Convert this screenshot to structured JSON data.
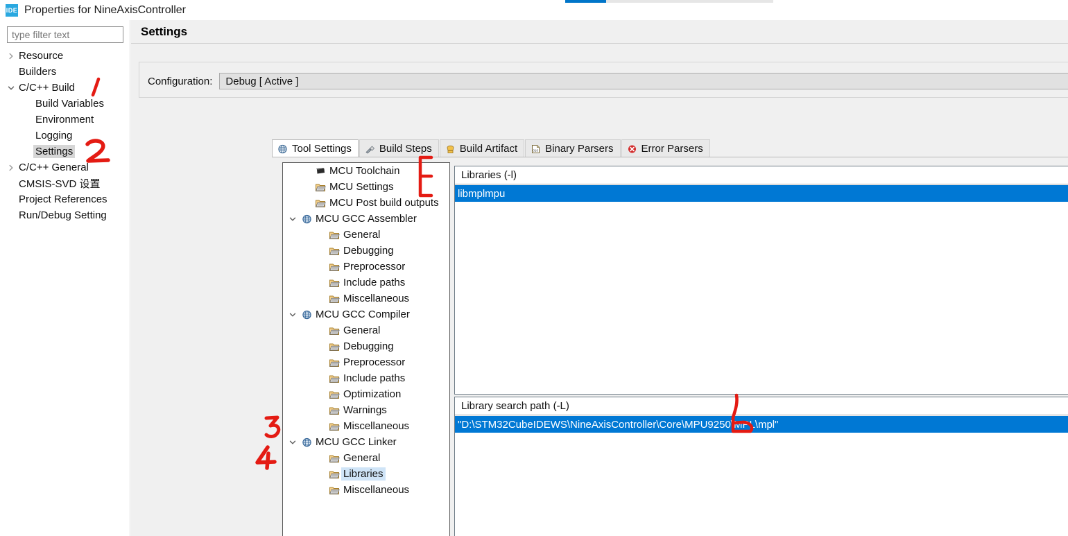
{
  "window": {
    "title": "Properties for NineAxisController",
    "app_icon": "ide-icon",
    "icon_text": "IDE"
  },
  "progress": {
    "percent": 20,
    "color": "#0075c9",
    "track_color": "#e6e6e6"
  },
  "sidebar": {
    "filter": {
      "placeholder": "type filter text",
      "value": ""
    },
    "items": [
      {
        "label": "Resource",
        "indent": 0,
        "twisty": "collapsed",
        "selected": false
      },
      {
        "label": "Builders",
        "indent": 0,
        "twisty": "none",
        "selected": false
      },
      {
        "label": "C/C++ Build",
        "indent": 0,
        "twisty": "expanded",
        "selected": false
      },
      {
        "label": "Build Variables",
        "indent": 1,
        "twisty": "none",
        "selected": false
      },
      {
        "label": "Environment",
        "indent": 1,
        "twisty": "none",
        "selected": false
      },
      {
        "label": "Logging",
        "indent": 1,
        "twisty": "none",
        "selected": false
      },
      {
        "label": "Settings",
        "indent": 1,
        "twisty": "none",
        "selected": true
      },
      {
        "label": "C/C++ General",
        "indent": 0,
        "twisty": "collapsed",
        "selected": false
      },
      {
        "label": "CMSIS-SVD 设置",
        "indent": 0,
        "twisty": "none",
        "selected": false
      },
      {
        "label": "Project References",
        "indent": 0,
        "twisty": "none",
        "selected": false
      },
      {
        "label": "Run/Debug Setting",
        "indent": 0,
        "twisty": "none",
        "selected": false
      }
    ]
  },
  "main": {
    "page_title": "Settings",
    "configuration": {
      "label": "Configuration:",
      "value": "Debug  [ Active ]"
    },
    "tabs": [
      {
        "label": "Tool Settings",
        "icon": "tool-settings-icon",
        "active": true
      },
      {
        "label": "Build Steps",
        "icon": "build-steps-icon",
        "active": false
      },
      {
        "label": "Build Artifact",
        "icon": "build-artifact-icon",
        "active": false
      },
      {
        "label": "Binary Parsers",
        "icon": "binary-parsers-icon",
        "active": false
      },
      {
        "label": "Error Parsers",
        "icon": "error-parsers-icon",
        "active": false
      }
    ],
    "tool_tree": [
      {
        "label": "MCU Toolchain",
        "indent": 1,
        "twisty": "none",
        "icon": "chip-icon",
        "selected": false
      },
      {
        "label": "MCU Settings",
        "indent": 1,
        "twisty": "none",
        "icon": "folder-icon",
        "selected": false
      },
      {
        "label": "MCU Post build outputs",
        "indent": 1,
        "twisty": "none",
        "icon": "folder-icon",
        "selected": false
      },
      {
        "label": "MCU GCC Assembler",
        "indent": 0,
        "twisty": "expanded",
        "icon": "globe-icon",
        "selected": false
      },
      {
        "label": "General",
        "indent": 2,
        "twisty": "none",
        "icon": "folder-icon",
        "selected": false
      },
      {
        "label": "Debugging",
        "indent": 2,
        "twisty": "none",
        "icon": "folder-icon",
        "selected": false
      },
      {
        "label": "Preprocessor",
        "indent": 2,
        "twisty": "none",
        "icon": "folder-icon",
        "selected": false
      },
      {
        "label": "Include paths",
        "indent": 2,
        "twisty": "none",
        "icon": "folder-icon",
        "selected": false
      },
      {
        "label": "Miscellaneous",
        "indent": 2,
        "twisty": "none",
        "icon": "folder-icon",
        "selected": false
      },
      {
        "label": "MCU GCC Compiler",
        "indent": 0,
        "twisty": "expanded",
        "icon": "globe-icon",
        "selected": false
      },
      {
        "label": "General",
        "indent": 2,
        "twisty": "none",
        "icon": "folder-icon",
        "selected": false
      },
      {
        "label": "Debugging",
        "indent": 2,
        "twisty": "none",
        "icon": "folder-icon",
        "selected": false
      },
      {
        "label": "Preprocessor",
        "indent": 2,
        "twisty": "none",
        "icon": "folder-icon",
        "selected": false
      },
      {
        "label": "Include paths",
        "indent": 2,
        "twisty": "none",
        "icon": "folder-icon",
        "selected": false
      },
      {
        "label": "Optimization",
        "indent": 2,
        "twisty": "none",
        "icon": "folder-icon",
        "selected": false
      },
      {
        "label": "Warnings",
        "indent": 2,
        "twisty": "none",
        "icon": "folder-icon",
        "selected": false
      },
      {
        "label": "Miscellaneous",
        "indent": 2,
        "twisty": "none",
        "icon": "folder-icon",
        "selected": false
      },
      {
        "label": "MCU GCC Linker",
        "indent": 0,
        "twisty": "expanded",
        "icon": "globe-icon",
        "selected": false
      },
      {
        "label": "General",
        "indent": 2,
        "twisty": "none",
        "icon": "folder-icon",
        "selected": false
      },
      {
        "label": "Libraries",
        "indent": 2,
        "twisty": "none",
        "icon": "folder-icon",
        "selected": true
      },
      {
        "label": "Miscellaneous",
        "indent": 2,
        "twisty": "none",
        "icon": "folder-icon",
        "selected": false
      }
    ],
    "libraries_panel": {
      "header": "Libraries (-l)",
      "items": [
        {
          "value": "libmplmpu",
          "selected": true
        }
      ]
    },
    "library_search_path_panel": {
      "header": "Library search path (-L)",
      "items": [
        {
          "value": "\"D:\\STM32CubeIDEWS\\NineAxisController\\Core\\MPU9250\\MPL\\mpl\"",
          "selected": true
        }
      ]
    }
  },
  "annotations": {
    "color": "#e41b13",
    "marks": [
      {
        "name": "mark-1",
        "text": "1"
      },
      {
        "name": "mark-2",
        "text": "2"
      },
      {
        "name": "mark-3",
        "text": "3"
      },
      {
        "name": "mark-4",
        "text": "4"
      },
      {
        "name": "bracket-libraries",
        "text": ""
      },
      {
        "name": "pointer-search-path",
        "text": ""
      }
    ]
  }
}
